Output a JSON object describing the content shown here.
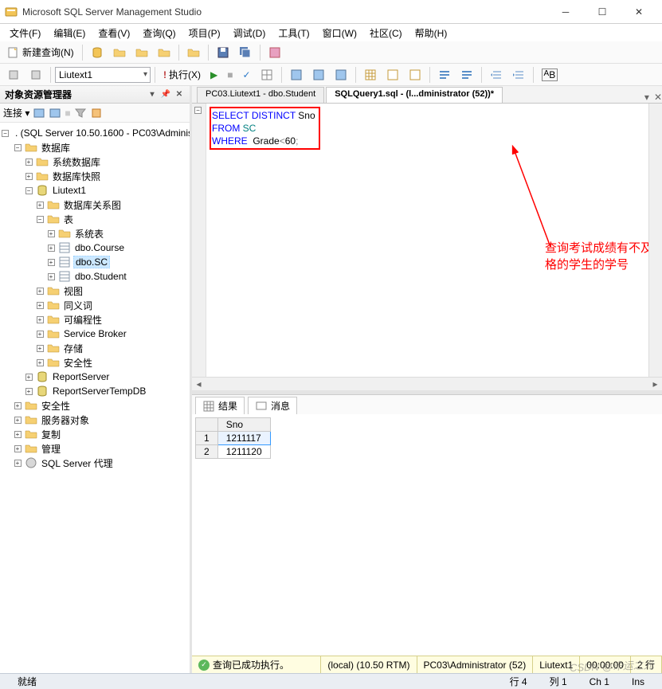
{
  "window": {
    "title": "Microsoft SQL Server Management Studio"
  },
  "menus": [
    "文件(F)",
    "编辑(E)",
    "查看(V)",
    "查询(Q)",
    "项目(P)",
    "调试(D)",
    "工具(T)",
    "窗口(W)",
    "社区(C)",
    "帮助(H)"
  ],
  "toolbar1": {
    "new_query": "新建查询(N)"
  },
  "toolbar2": {
    "combo": "Liutext1",
    "execute": "执行(X)"
  },
  "object_explorer": {
    "title": "对象资源管理器",
    "connect_label": "连接 ▾",
    "root": ". (SQL Server 10.50.1600 - PC03\\Administ",
    "nodes": {
      "databases": "数据库",
      "sys_db": "系统数据库",
      "db_snap": "数据库快照",
      "liutext1": "Liutext1",
      "db_diagram": "数据库关系图",
      "tables": "表",
      "sys_tables": "系统表",
      "t_course": "dbo.Course",
      "t_sc": "dbo.SC",
      "t_student": "dbo.Student",
      "views": "视图",
      "synonyms": "同义词",
      "programmability": "可编程性",
      "service_broker": "Service Broker",
      "storage": "存储",
      "security_db": "安全性",
      "report_server": "ReportServer",
      "report_server_temp": "ReportServerTempDB",
      "security": "安全性",
      "server_objects": "服务器对象",
      "replication": "复制",
      "management": "管理",
      "sql_agent": "SQL Server 代理"
    }
  },
  "tabs": [
    {
      "label": "PC03.Liutext1 - dbo.Student",
      "active": false
    },
    {
      "label": "SQLQuery1.sql - (l...dministrator (52))*",
      "active": true
    }
  ],
  "sql": {
    "line1_kw1": "SELECT",
    "line1_kw2": "DISTINCT",
    "line1_col": "Sno",
    "line2_kw": "FROM",
    "line2_tbl": "SC",
    "line3_kw": "WHERE",
    "line3_col": "Grade",
    "line3_op": "<",
    "line3_val": "60",
    "line3_semi": ";"
  },
  "annotation": "查询考试成绩有不及格的学生的学号",
  "results": {
    "tab_results": "结果",
    "tab_messages": "消息",
    "columns": [
      "Sno"
    ],
    "rows": [
      {
        "n": "1",
        "Sno": "1211117"
      },
      {
        "n": "2",
        "Sno": "1211120"
      }
    ]
  },
  "sql_status": {
    "ok": "查询已成功执行。",
    "server": "(local) (10.50 RTM)",
    "user": "PC03\\Administrator (52)",
    "db": "Liutext1",
    "time": "00:00:00",
    "rows": "2 行"
  },
  "statusbar": {
    "ready": "就绪",
    "line": "行 4",
    "col": "列 1",
    "ch": "Ch 1",
    "ins": "Ins"
  },
  "watermark": "CSDN @命运之光"
}
